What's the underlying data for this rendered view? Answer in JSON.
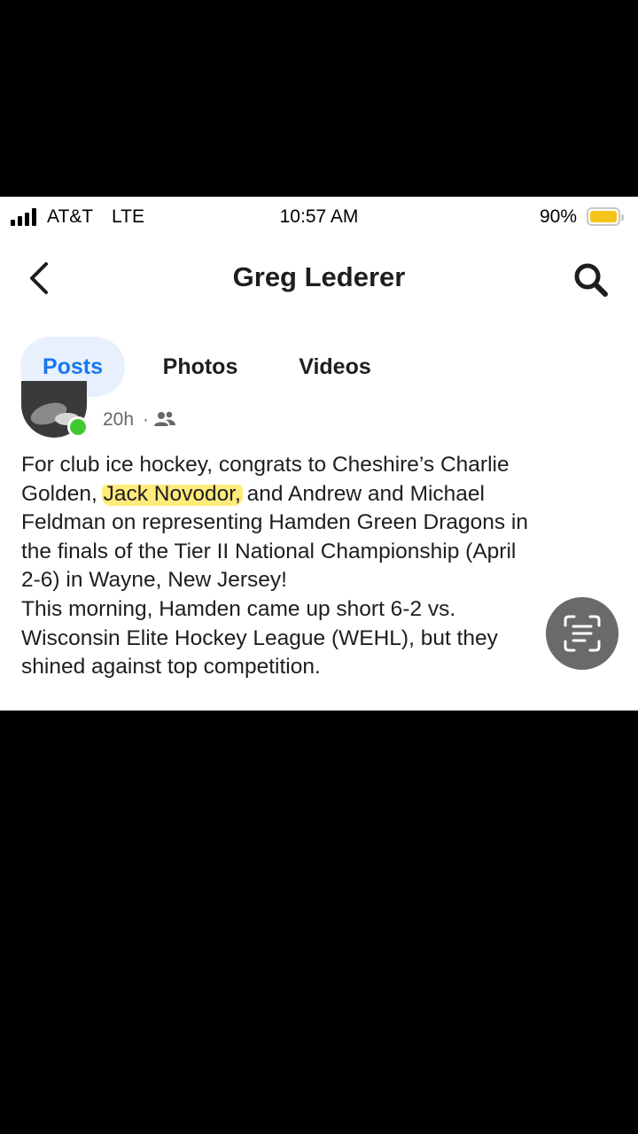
{
  "status_bar": {
    "carrier": "AT&T",
    "network": "LTE",
    "time": "10:57 AM",
    "battery_percent": "90%",
    "battery_level": 0.9,
    "battery_color": "#f5c51a"
  },
  "header": {
    "title": "Greg Lederer",
    "back_icon": "chevron-left-icon",
    "search_icon": "search-icon"
  },
  "tabs": [
    {
      "label": "Posts",
      "active": true
    },
    {
      "label": "Photos",
      "active": false
    },
    {
      "label": "Videos",
      "active": false
    }
  ],
  "post": {
    "time_ago": "20h",
    "separator": "·",
    "audience_icon": "friends-icon",
    "online": true,
    "body": {
      "line1": "For club ice hockey, congrats to Cheshire’s Charlie",
      "line2_pre": "Golden, ",
      "line2_highlight": "Jack Novodor,",
      "line2_post": " and Andrew and Michael",
      "line3": "Feldman on representing Hamden Green Dragons in",
      "line4": "the finals of the Tier II National Championship (April",
      "line5": "2-6) in Wayne, New Jersey!",
      "line6": "This morning, Hamden came up short 6-2 vs.",
      "line7": "Wisconsin Elite Hockey League (WEHL), but they",
      "line8": "shined against top competition."
    },
    "highlight_color": "#ffe13c"
  },
  "overlay": {
    "live_text_icon": "live-text-icon"
  }
}
